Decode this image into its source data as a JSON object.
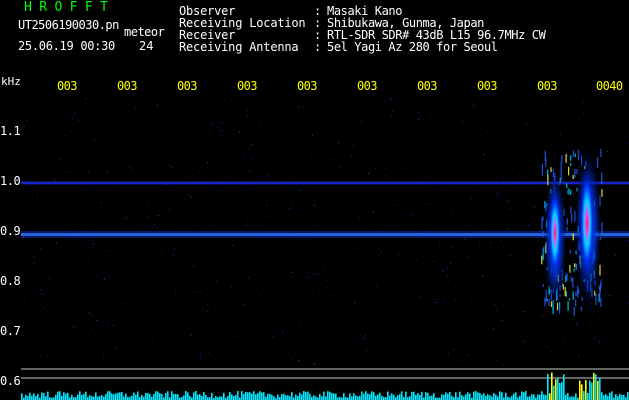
{
  "header": {
    "app_title": "HROFFT",
    "filename": "UT2506190030.pn",
    "mode": "meteor",
    "timestamp": "25.06.19 00:30",
    "count": "24"
  },
  "info": [
    {
      "label": "Observer",
      "value": "Masaki Kano"
    },
    {
      "label": "Receiving Location",
      "value": "Shibukawa, Gunma, Japan"
    },
    {
      "label": "Receiver",
      "value": "RTL-SDR SDR# 43dB L15 96.7MHz CW"
    },
    {
      "label": "Receiving Antenna",
      "value": "5el Yagi Az 280 for Seoul"
    }
  ],
  "axis": {
    "unit_label": "kHz",
    "time_ticks": [
      "003",
      "003",
      "003",
      "003",
      "003",
      "003",
      "003",
      "003",
      "003",
      "0040"
    ],
    "freq_ticks": [
      "1.1",
      "1.0",
      "0.9",
      "0.8",
      "0.7",
      "0.6"
    ]
  },
  "colors": {
    "background": "#000000",
    "title": "#00ff00",
    "time_ticks": "#ffff00",
    "signal_strong": "#ff0000",
    "signal_mid": "#00ffff",
    "signal_low": "#0000ff",
    "histogram": "#00ffff",
    "histogram_peak": "#ffff00"
  }
}
